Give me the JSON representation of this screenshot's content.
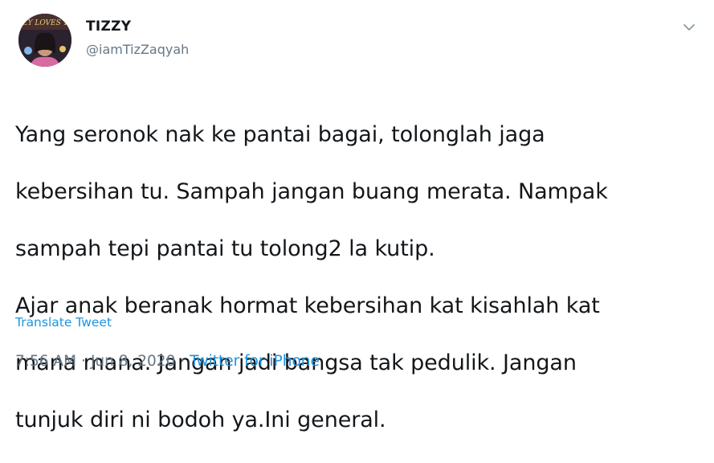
{
  "tweet": {
    "author": {
      "display_name": "TIZZY",
      "handle": "@iamTizZaqyah",
      "avatar_banner_text": "TIZZY LOVES YOU"
    },
    "menu_icon": "chevron-down-icon",
    "text_lines": [
      "Yang seronok nak ke pantai bagai, tolonglah jaga",
      "kebersihan tu. Sampah jangan buang merata. Nampak",
      "sampah tepi pantai tu tolong2 la kutip.",
      "Ajar anak beranak hormat kebersihan kat kisahlah kat",
      "mana mana. Jangan jadi bangsa tak pedulik. Jangan",
      "tunjuk diri ni bodoh ya.Ini general."
    ],
    "translate_label": "Translate Tweet",
    "time": "7:56 AM",
    "separator": "·",
    "date": "Jun 8, 2020",
    "source": "Twitter for iPhone"
  },
  "colors": {
    "text": "#14171a",
    "secondary": "#657786",
    "link": "#1b95e0"
  }
}
